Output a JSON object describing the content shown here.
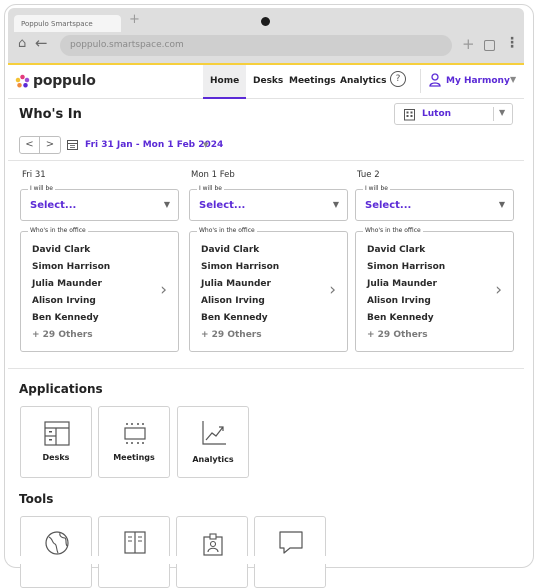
{
  "browser": {
    "tab_title": "Poppulo Smartspace",
    "new_tab": "+",
    "url": "poppulo.smartspace.com",
    "icons": [
      "home-icon",
      "back-icon",
      "plus-icon",
      "square-icon",
      "kebab-icon"
    ]
  },
  "header": {
    "logo_text": "poppulo",
    "nav": [
      "Home",
      "Desks",
      "Meetings",
      "Analytics"
    ],
    "active_nav": "Home",
    "help_label": "?",
    "user_name": "My Harmony",
    "accent": "#5b2ad6",
    "top_border_color": "#f6cf3c"
  },
  "page": {
    "title": "Who's In",
    "location": "Luton",
    "date_range": "Fri 31 Jan - Mon 1 Feb 2024",
    "prev_label": "<",
    "next_label": ">"
  },
  "days": [
    {
      "label": "Fri 31",
      "will_be_legend": "I will be",
      "select_value": "Select...",
      "office_legend": "Who's in the office",
      "people": [
        "David Clark",
        "Simon Harrison",
        "Julia Maunder",
        "Alison Irving",
        "Ben Kennedy"
      ],
      "others": "+ 29 Others"
    },
    {
      "label": "Mon 1 Feb",
      "will_be_legend": "I will be",
      "select_value": "Select...",
      "office_legend": "Who's in the office",
      "people": [
        "David Clark",
        "Simon Harrison",
        "Julia Maunder",
        "Alison Irving",
        "Ben Kennedy"
      ],
      "others": "+ 29 Others"
    },
    {
      "label": "Tue 2",
      "will_be_legend": "I will be",
      "select_value": "Select...",
      "office_legend": "Who's in the office",
      "people": [
        "David Clark",
        "Simon Harrison",
        "Julia Maunder",
        "Alison Irving",
        "Ben Kennedy"
      ],
      "others": "+ 29 Others"
    }
  ],
  "applications": {
    "title": "Applications",
    "items": [
      {
        "label": "Desks",
        "icon": "desk-icon"
      },
      {
        "label": "Meetings",
        "icon": "meeting-room-icon"
      },
      {
        "label": "Analytics",
        "icon": "chart-line-icon"
      }
    ]
  },
  "tools": {
    "title": "Tools",
    "items": [
      {
        "icon": "globe-icon"
      },
      {
        "icon": "book-icon"
      },
      {
        "icon": "badge-icon"
      },
      {
        "icon": "message-icon"
      }
    ]
  }
}
